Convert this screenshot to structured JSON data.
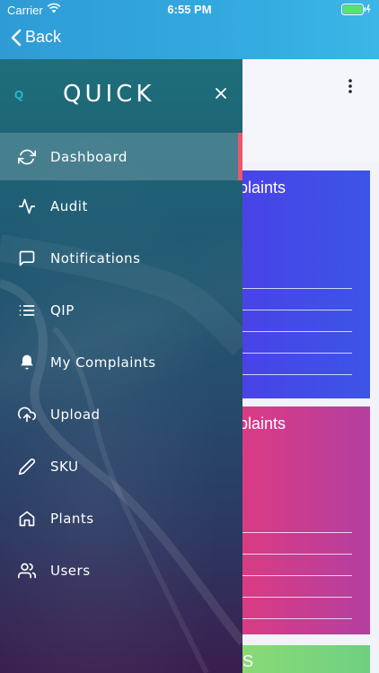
{
  "status_bar": {
    "carrier": "Carrier",
    "time": "6:55 PM"
  },
  "nav": {
    "back_label": "Back"
  },
  "drawer": {
    "logo_letter": "Q",
    "brand": "QUICK",
    "close_glyph": "×",
    "items": [
      {
        "label": "Dashboard",
        "icon": "refresh-icon",
        "active": true
      },
      {
        "label": "Audit",
        "icon": "activity-icon"
      },
      {
        "label": "Notifications",
        "icon": "message-square-icon"
      },
      {
        "label": "QIP",
        "icon": "list-icon"
      },
      {
        "label": "My Complaints",
        "icon": "bell-icon"
      },
      {
        "label": "Upload",
        "icon": "upload-cloud-icon"
      },
      {
        "label": "SKU",
        "icon": "pencil-icon"
      },
      {
        "label": "Plants",
        "icon": "home-icon"
      },
      {
        "label": "Users",
        "icon": "users-icon"
      }
    ],
    "active_indicator_color": "#f0566a"
  },
  "main": {
    "cards": [
      {
        "title": "nplaints",
        "color": "#3f4ae7"
      },
      {
        "title": "nplaints",
        "color": "#c93c8f"
      },
      {
        "title": "QS",
        "color": "#7fd67a"
      }
    ]
  }
}
